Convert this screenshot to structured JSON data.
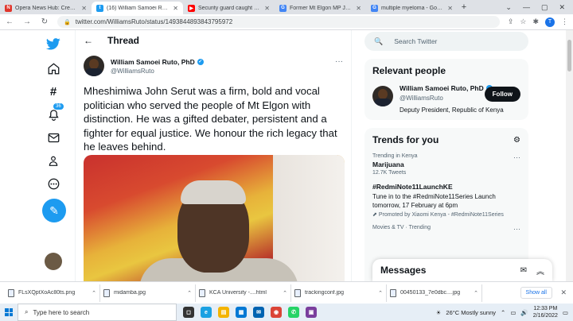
{
  "browser": {
    "tabs": [
      {
        "title": "Opera News Hub: Create, Sh...",
        "favicon": "N",
        "color": "#e0352b"
      },
      {
        "title": "(16) William Samoei Ruto, Ph...",
        "favicon": "t",
        "color": "#1d9bf0",
        "active": true
      },
      {
        "title": "Security guard caught recei...",
        "favicon": "▶",
        "color": "#ff0000"
      },
      {
        "title": "Former Mt Elgon MP John Se...",
        "favicon": "G",
        "color": "#4285f4"
      },
      {
        "title": "multiple myeloma - Google ...",
        "favicon": "G",
        "color": "#4285f4"
      }
    ],
    "url": "twitter.com/WilliamsRuto/status/1493844893843795972",
    "profile_initial": "T"
  },
  "leftnav": {
    "notification_badge": "36"
  },
  "thread": {
    "header_title": "Thread",
    "author_name": "William Samoei Ruto, PhD",
    "author_handle": "@WilliamsRuto",
    "text": "Mheshimiwa John Serut was a firm, bold and vocal politician who served the people of Mt Elgon with distinction. He was a gifted debater, persistent and a fighter for equal justice. We honour the rich legacy that he leaves behind."
  },
  "sidebar": {
    "search_placeholder": "Search Twitter",
    "relevant_title": "Relevant people",
    "relevant": {
      "name": "William Samoei Ruto, PhD",
      "handle": "@WilliamsRuto",
      "bio": "Deputy President, Republic of Kenya",
      "follow_label": "Follow"
    },
    "trends_title": "Trends for you",
    "trends": [
      {
        "context": "Trending in Kenya",
        "name": "Marijuana",
        "count": "12.7K Tweets"
      },
      {
        "context": "",
        "name": "#RedmiNote11LaunchKE",
        "desc": "Tune in to the #RedmiNote11Series Launch tomorrow, 17 February at 6pm",
        "promo": "Promoted by Xiaomi Kenya - #RedmiNote11Series"
      },
      {
        "context": "Movies & TV · Trending",
        "name": ""
      }
    ],
    "messages_title": "Messages"
  },
  "downloads": {
    "files": [
      "FLsXQptXoAc80ts.png",
      "midamba.jpg",
      "KCA University -....html",
      "trackingconf.jpg",
      "00450133_7e0dbc....jpg"
    ],
    "show_all": "Show all"
  },
  "taskbar": {
    "search_placeholder": "Type here to search",
    "weather": "26°C  Mostly sunny",
    "time": "12:33 PM",
    "date": "2/16/2022"
  }
}
